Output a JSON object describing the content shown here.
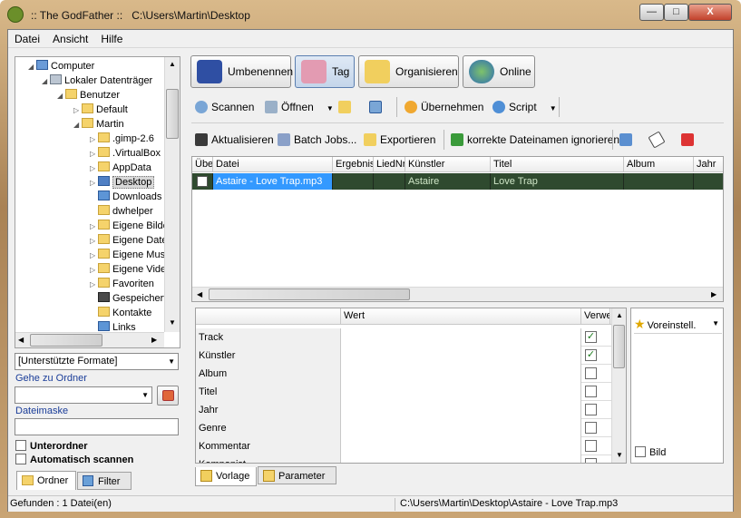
{
  "window": {
    "title": ":: The GodFather ::",
    "path": "C:\\Users\\Martin\\Desktop",
    "min": "—",
    "max": "□",
    "close": "X"
  },
  "menu": [
    "Datei",
    "Ansicht",
    "Hilfe"
  ],
  "tree": {
    "items": [
      "Computer",
      "Lokaler Datenträger",
      "Benutzer",
      "Default",
      "Martin",
      ".gimp-2.6",
      ".VirtualBox",
      "AppData",
      "Desktop",
      "Downloads",
      "dwhelper",
      "Eigene Bilder",
      "Eigene Dateien",
      "Eigene Musik",
      "Eigene Videos",
      "Favoriten",
      "Gespeicherte Spiele",
      "Kontakte",
      "Links"
    ],
    "selected": "Desktop"
  },
  "left": {
    "format_filter": "[Unterstützte Formate]",
    "goto_label": "Gehe zu Ordner",
    "goto_value": "",
    "mask_label": "Dateimaske",
    "mask_value": "",
    "subfolders": "Unterordner",
    "autoscan": "Automatisch scannen",
    "tabs": [
      "Ordner",
      "Filter"
    ]
  },
  "modes": [
    "Umbenennen",
    "Tag",
    "Organisieren",
    "Online"
  ],
  "active_mode": "Tag",
  "toolbar1": {
    "scan": "Scannen",
    "open": "Öffnen",
    "apply": "Übernehmen",
    "script": "Script"
  },
  "toolbar2": {
    "update": "Aktualisieren",
    "batch": "Batch Jobs...",
    "export": "Exportieren",
    "ignore": "korrekte Dateinamen ignorieren"
  },
  "files": {
    "columns": [
      "Übe",
      "Datei",
      "Ergebnis",
      "LiedNr",
      "Künstler",
      "Titel",
      "Album",
      "Jahr"
    ],
    "rows": [
      {
        "checked": false,
        "file": "Astaire - Love Trap.mp3",
        "ergebnis": "",
        "liednr": "",
        "kuenstler": "Astaire",
        "titel": "Love Trap",
        "album": "",
        "jahr": ""
      }
    ]
  },
  "tags": {
    "col_value": "Wert",
    "col_use": "Verwe",
    "rows": [
      {
        "name": "Track",
        "value": "",
        "use": true
      },
      {
        "name": "Künstler",
        "value": "",
        "use": true
      },
      {
        "name": "Album",
        "value": "",
        "use": false
      },
      {
        "name": "Titel",
        "value": "",
        "use": false
      },
      {
        "name": "Jahr",
        "value": "",
        "use": false
      },
      {
        "name": "Genre",
        "value": "",
        "use": false
      },
      {
        "name": "Kommentar",
        "value": "",
        "use": false
      },
      {
        "name": "Komponist",
        "value": "",
        "use": false
      }
    ],
    "preset": "Voreinstell.",
    "picture": "Bild",
    "tabs": [
      "Vorlage",
      "Parameter"
    ]
  },
  "status": {
    "found": "Gefunden : 1 Datei(en)",
    "file": "C:\\Users\\Martin\\Desktop\\Astaire - Love Trap.mp3"
  },
  "colors": {
    "selection": "#3399ff",
    "filerow": "#2f4a2f",
    "accent": "#1a3d99"
  }
}
